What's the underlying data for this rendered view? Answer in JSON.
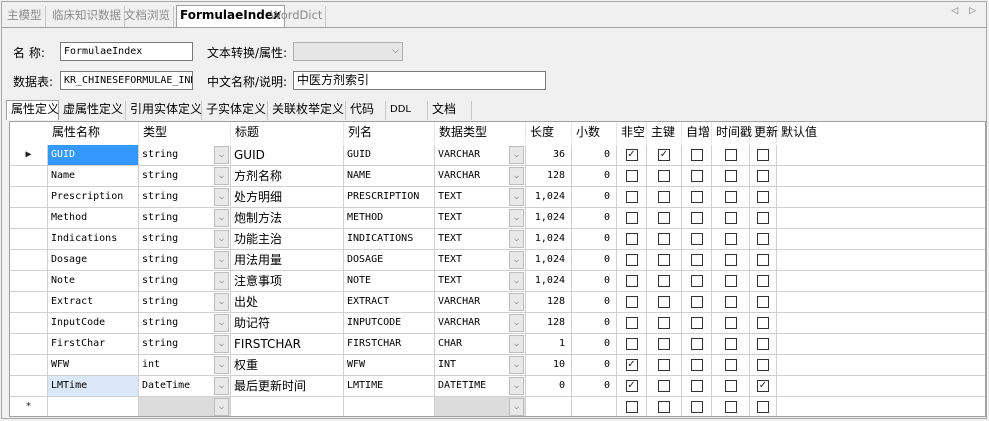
{
  "doc_tabs": [
    "主模型",
    "临床知识数据",
    "文档浏览",
    "FormulaeIndex",
    "WordDict"
  ],
  "nav_arrows": "◁ ▷",
  "form": {
    "name_label": "名  称:",
    "name_value": "FormulaeIndex",
    "table_label": "数据表:",
    "table_value": "KR_CHINESEFORMULAE_INDEX",
    "convert_label": "文本转换/属性:",
    "cn_label": "中文名称/说明:",
    "cn_value": "中医方剂索引"
  },
  "inner_tabs": [
    "属性定义",
    "虚属性定义",
    "引用实体定义",
    "子实体定义",
    "关联枚举定义",
    "代码",
    "DDL",
    "文档"
  ],
  "columns": [
    "属性名称",
    "类型",
    "标题",
    "列名",
    "数据类型",
    "长度",
    "小数",
    "非空",
    "主键",
    "自增",
    "时间戳",
    "更新",
    "默认值"
  ],
  "rows": [
    {
      "name": "GUID",
      "type": "string",
      "title": "GUID",
      "col": "GUID",
      "dtype": "VARCHAR",
      "len": "36",
      "dec": "0",
      "notnull": true,
      "pk": true,
      "auto": false,
      "ts": false,
      "upd": false
    },
    {
      "name": "Name",
      "type": "string",
      "title": "方剂名称",
      "col": "NAME",
      "dtype": "VARCHAR",
      "len": "128",
      "dec": "0",
      "notnull": false,
      "pk": false,
      "auto": false,
      "ts": false,
      "upd": false
    },
    {
      "name": "Prescription",
      "type": "string",
      "title": "处方明细",
      "col": "PRESCRIPTION",
      "dtype": "TEXT",
      "len": "1,024",
      "dec": "0",
      "notnull": false,
      "pk": false,
      "auto": false,
      "ts": false,
      "upd": false
    },
    {
      "name": "Method",
      "type": "string",
      "title": "炮制方法",
      "col": "METHOD",
      "dtype": "TEXT",
      "len": "1,024",
      "dec": "0",
      "notnull": false,
      "pk": false,
      "auto": false,
      "ts": false,
      "upd": false
    },
    {
      "name": "Indications",
      "type": "string",
      "title": "功能主治",
      "col": "INDICATIONS",
      "dtype": "TEXT",
      "len": "1,024",
      "dec": "0",
      "notnull": false,
      "pk": false,
      "auto": false,
      "ts": false,
      "upd": false
    },
    {
      "name": "Dosage",
      "type": "string",
      "title": "用法用量",
      "col": "DOSAGE",
      "dtype": "TEXT",
      "len": "1,024",
      "dec": "0",
      "notnull": false,
      "pk": false,
      "auto": false,
      "ts": false,
      "upd": false
    },
    {
      "name": "Note",
      "type": "string",
      "title": "注意事项",
      "col": "NOTE",
      "dtype": "TEXT",
      "len": "1,024",
      "dec": "0",
      "notnull": false,
      "pk": false,
      "auto": false,
      "ts": false,
      "upd": false
    },
    {
      "name": "Extract",
      "type": "string",
      "title": "出处",
      "col": "EXTRACT",
      "dtype": "VARCHAR",
      "len": "128",
      "dec": "0",
      "notnull": false,
      "pk": false,
      "auto": false,
      "ts": false,
      "upd": false
    },
    {
      "name": "InputCode",
      "type": "string",
      "title": "助记符",
      "col": "INPUTCODE",
      "dtype": "VARCHAR",
      "len": "128",
      "dec": "0",
      "notnull": false,
      "pk": false,
      "auto": false,
      "ts": false,
      "upd": false
    },
    {
      "name": "FirstChar",
      "type": "string",
      "title": "FIRSTCHAR",
      "col": "FIRSTCHAR",
      "dtype": "CHAR",
      "len": "1",
      "dec": "0",
      "notnull": false,
      "pk": false,
      "auto": false,
      "ts": false,
      "upd": false
    },
    {
      "name": "WFW",
      "type": "int",
      "title": "权重",
      "col": "WFW",
      "dtype": "INT",
      "len": "10",
      "dec": "0",
      "notnull": true,
      "pk": false,
      "auto": false,
      "ts": false,
      "upd": false
    },
    {
      "name": "LMTime",
      "type": "DateTime",
      "title": "最后更新时间",
      "col": "LMTIME",
      "dtype": "DATETIME",
      "len": "0",
      "dec": "0",
      "notnull": true,
      "pk": false,
      "auto": false,
      "ts": false,
      "upd": true
    }
  ],
  "current_row_marker": "▶",
  "new_row_marker": "*"
}
